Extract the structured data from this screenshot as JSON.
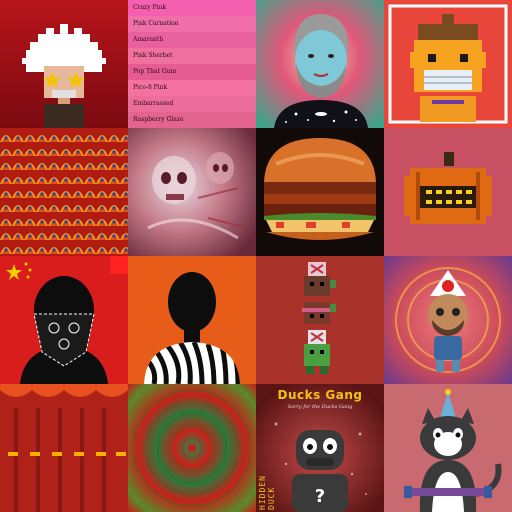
{
  "swatch_list": [
    {
      "label": "Crazy Pink",
      "color": "#f45fb0"
    },
    {
      "label": "Pink Carnation",
      "color": "#f06fa8"
    },
    {
      "label": "Amaranth",
      "color": "#e8609e"
    },
    {
      "label": "Pink Sherbet",
      "color": "#f0709e"
    },
    {
      "label": "Pop That Gum",
      "color": "#e65b93"
    },
    {
      "label": "Pico-8 Pink",
      "color": "#f4729f"
    },
    {
      "label": "Embarrassed",
      "color": "#ec6d9a"
    },
    {
      "label": "Raspberry Glaze",
      "color": "#e2648f"
    }
  ],
  "ducks_gang": {
    "title": "Ducks Gang",
    "subtitle": "Sorry for the Ducks Gang",
    "side_text": "HIDDEN DUCK"
  },
  "tiles": [
    {
      "name": "tile-pixel-einstein",
      "icon": "pixel-scientist"
    },
    {
      "name": "tile-color-swatches",
      "icon": "pink-swatch-list"
    },
    {
      "name": "tile-bearded-man",
      "icon": "cartoon-man-portrait"
    },
    {
      "name": "tile-pixel-boy",
      "icon": "pixel-boy-mask"
    },
    {
      "name": "tile-scale-pattern",
      "icon": "red-scale-pattern"
    },
    {
      "name": "tile-skull-abstract",
      "icon": "skull-collage"
    },
    {
      "name": "tile-burger",
      "icon": "burger"
    },
    {
      "name": "tile-pumpkin",
      "icon": "pixel-pumpkin"
    },
    {
      "name": "tile-bandana-figure",
      "icon": "masked-silhouette"
    },
    {
      "name": "tile-zebra-figure",
      "icon": "zebra-shirt-silhouette"
    },
    {
      "name": "tile-pixel-stack",
      "icon": "pixel-creature-stack"
    },
    {
      "name": "tile-doodle-character",
      "icon": "doodle-character"
    },
    {
      "name": "tile-pixel-robes",
      "icon": "pixel-red-robes"
    },
    {
      "name": "tile-radial-green",
      "icon": "radial-pattern"
    },
    {
      "name": "tile-ducks-gang",
      "icon": "duck-character"
    },
    {
      "name": "tile-party-cat",
      "icon": "party-hat-cat"
    }
  ],
  "colors": {
    "einstein_bg": "#a0141a",
    "bearded_bg": "#d9542f",
    "pixel_boy_bg": "#e8453b",
    "scale_bg": "#b01b12",
    "burger_bg": "#120a08",
    "pumpkin_bg": "#c75063",
    "bandana_bg": "#d91c1c",
    "zebra_bg": "#e85c1a",
    "stack_bg": "#a9322a",
    "doodle_bg": "#c94a5a",
    "robes_bg": "#b0211a",
    "radial_bg": "#c4221b",
    "ducks_bg": "#7a1e1c",
    "cat_bg": "#c86a70"
  }
}
